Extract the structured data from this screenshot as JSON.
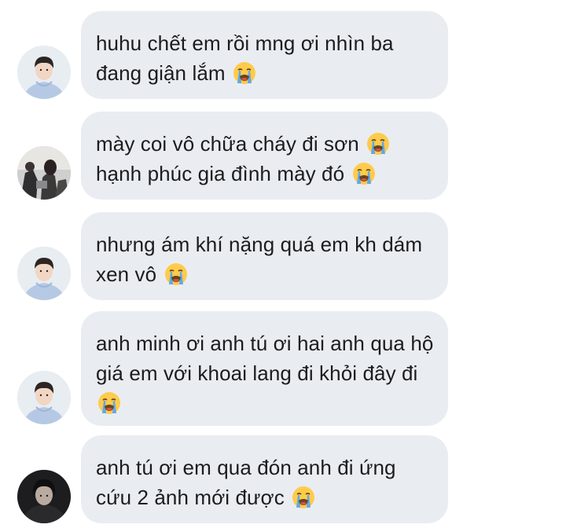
{
  "messages": [
    {
      "sender": "boy-hoodie",
      "text": "huhu chết em rồi mng ơi nhìn ba đang giận lắm",
      "emoji": "loudly-crying-face"
    },
    {
      "sender": "group-photo",
      "text": "mày coi vô chữa cháy đi sơn",
      "emoji": "loudly-crying-face",
      "text2": "hạnh phúc gia đình mày đó",
      "emoji2": "loudly-crying-face"
    },
    {
      "sender": "boy-hoodie",
      "text": "nhưng ám khí nặng quá em kh dám xen vô",
      "emoji": "loudly-crying-face"
    },
    {
      "sender": "boy-hoodie",
      "text": "anh minh ơi anh tú ơi hai anh qua hộ giá em với khoai lang đi khỏi đây đi",
      "emoji": "loudly-crying-face"
    },
    {
      "sender": "dark-photo",
      "text": "anh tú ơi em qua đón anh đi ứng cứu 2 ảnh mới được",
      "emoji": "loudly-crying-face"
    }
  ],
  "colors": {
    "bubble": "#e9edf1",
    "text": "#1c1c1e",
    "emoji_face": "#ffcb4c",
    "emoji_tears": "#5fa8e8"
  }
}
